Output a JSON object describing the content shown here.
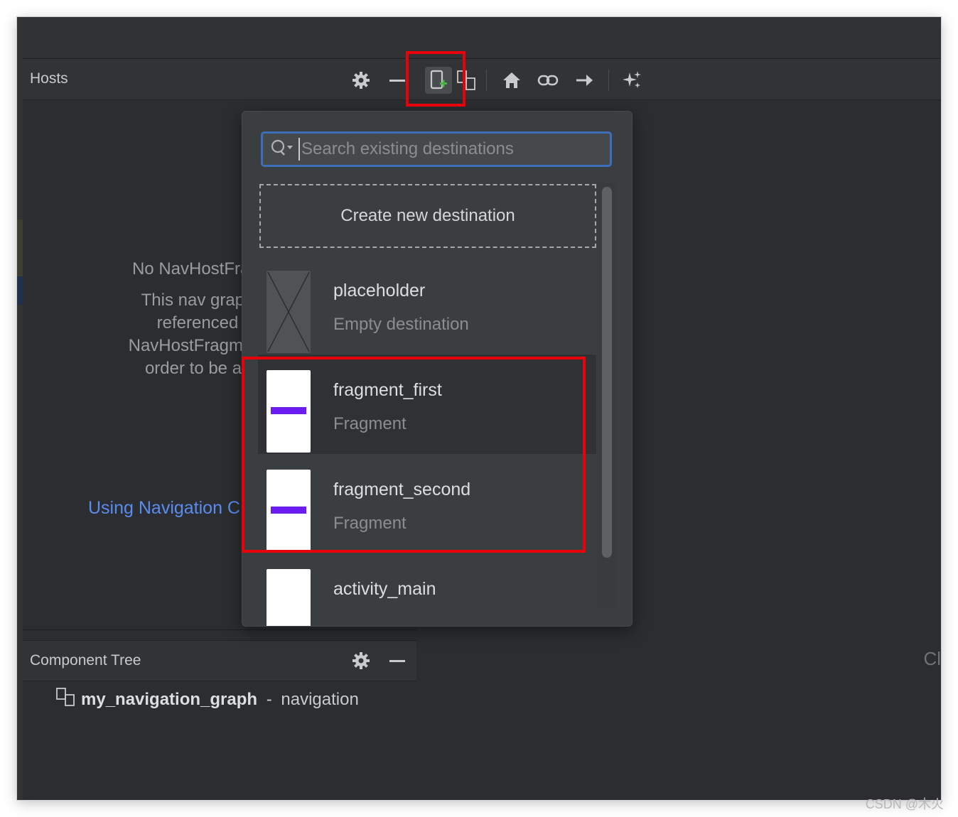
{
  "hosts_panel": {
    "title": "Hosts"
  },
  "toolbar": {
    "icons": [
      "gear-icon",
      "minimize-icon",
      "new-destination-icon",
      "nested-graph-icon",
      "home-icon",
      "link-icon",
      "action-arrow-icon",
      "auto-arrange-icon"
    ]
  },
  "empty_state": {
    "line1": "No NavHostFragi",
    "line2": "This nav graph",
    "line3": "referenced",
    "line4": "NavHostFragment",
    "line5": "order to be ac",
    "link": "Using Navigation C"
  },
  "destination_popup": {
    "search_placeholder": "Search existing destinations",
    "create_label": "Create new destination",
    "destinations": [
      {
        "name": "placeholder",
        "type": "Empty destination"
      },
      {
        "name": "fragment_first",
        "type": "Fragment"
      },
      {
        "name": "fragment_second",
        "type": "Fragment"
      },
      {
        "name": "activity_main",
        "type": ""
      }
    ]
  },
  "component_tree": {
    "title": "Component Tree",
    "root_name": "my_navigation_graph",
    "root_separator": " - ",
    "root_type": "navigation"
  },
  "right_panel": {
    "partial_text": "Cl"
  },
  "watermark": "CSDN @木火",
  "colors": {
    "highlight": "#e8000b",
    "accent": "#3d6fb8",
    "link": "#5a8cf0",
    "thumb_bar": "#6a1cf2"
  }
}
